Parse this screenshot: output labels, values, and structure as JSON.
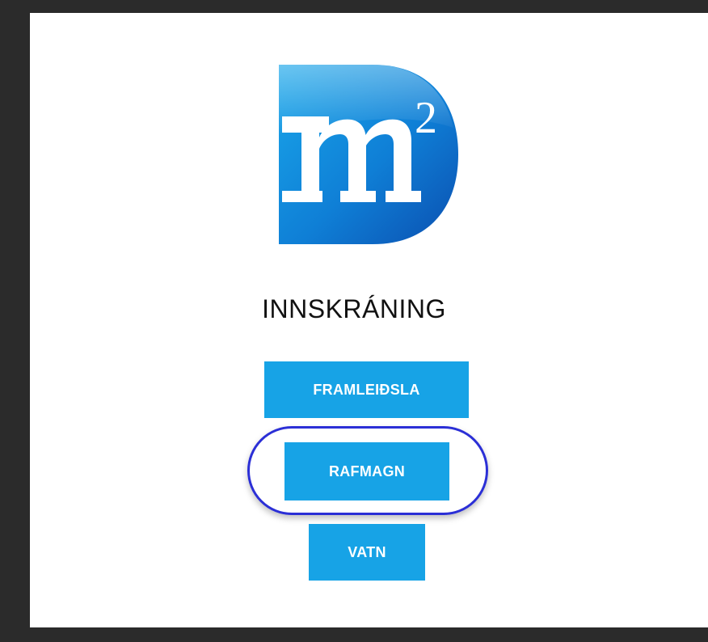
{
  "colors": {
    "button": "#17a3e6",
    "highlight": "#2b2fd6",
    "frame": "#2b2b2b"
  },
  "logo": {
    "icon": "m2-d-logo"
  },
  "login": {
    "title": "INNSKRÁNING"
  },
  "buttons": {
    "framleidsla": "FRAMLEIÐSLA",
    "rafmagn": "RAFMAGN",
    "vatn": "VATN"
  }
}
